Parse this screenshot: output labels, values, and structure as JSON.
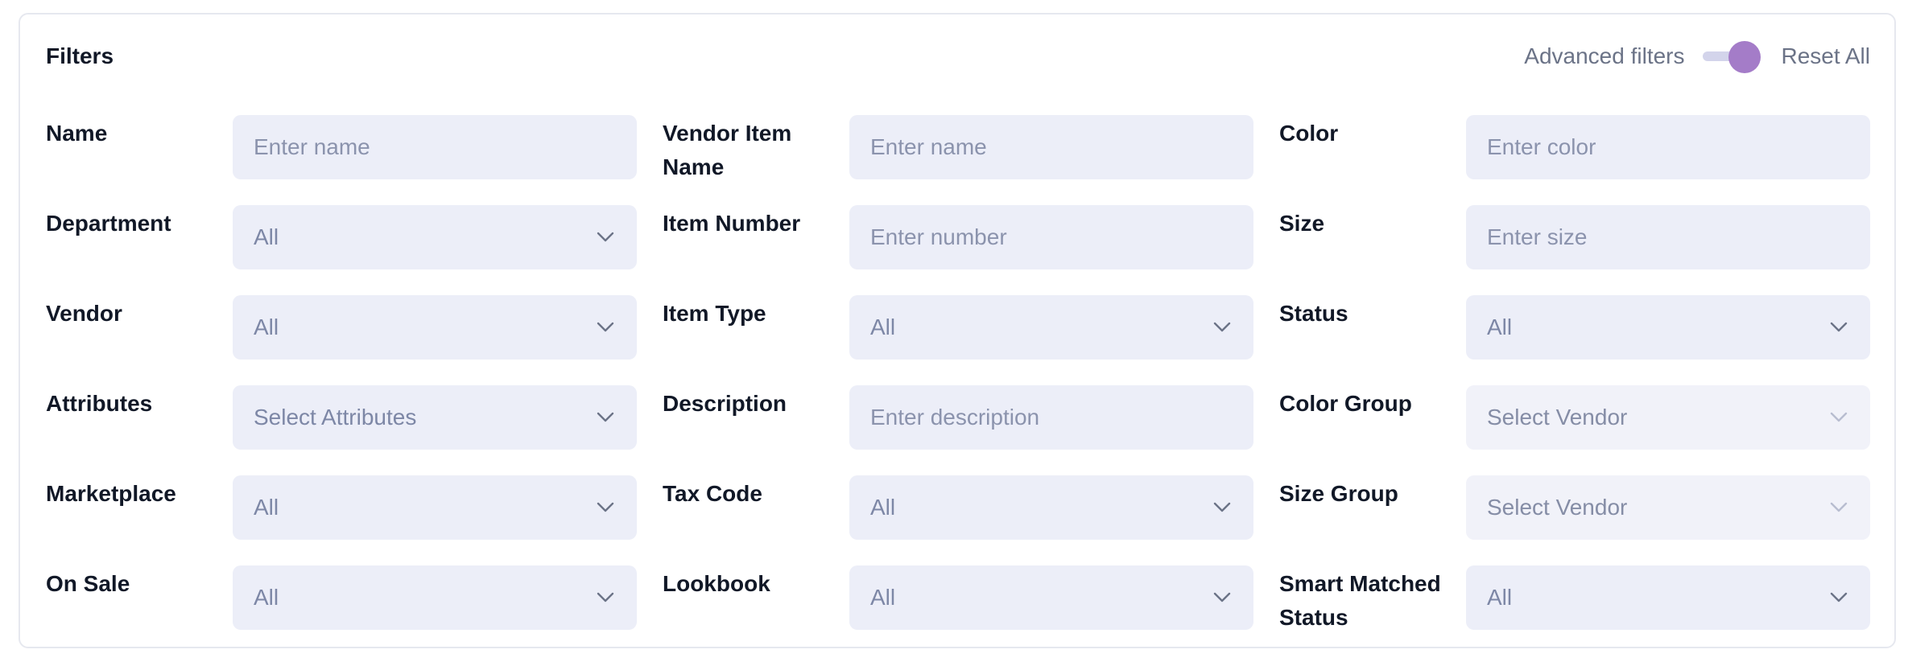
{
  "header": {
    "title": "Filters",
    "advanced_label": "Advanced filters",
    "advanced_enabled": true,
    "reset_label": "Reset All"
  },
  "colors": {
    "accent": "#a47cc8",
    "field_bg": "#eceef8",
    "label": "#111827",
    "muted": "#6b7387"
  },
  "rows": [
    [
      {
        "label": "Name",
        "type": "input",
        "placeholder": "Enter name"
      },
      {
        "label": "Vendor Item Name",
        "type": "input",
        "placeholder": "Enter name"
      },
      {
        "label": "Color",
        "type": "input",
        "placeholder": "Enter color"
      }
    ],
    [
      {
        "label": "Department",
        "type": "select",
        "value": "All"
      },
      {
        "label": "Item Number",
        "type": "input",
        "placeholder": "Enter number"
      },
      {
        "label": "Size",
        "type": "input",
        "placeholder": "Enter size"
      }
    ],
    [
      {
        "label": "Vendor",
        "type": "select",
        "value": "All"
      },
      {
        "label": "Item Type",
        "type": "select",
        "value": "All"
      },
      {
        "label": "Status",
        "type": "select",
        "value": "All"
      }
    ],
    [
      {
        "label": "Attributes",
        "type": "select",
        "value": "Select Attributes"
      },
      {
        "label": "Description",
        "type": "input",
        "placeholder": "Enter description"
      },
      {
        "label": "Color Group",
        "type": "select",
        "value": "Select Vendor",
        "disabled": true
      }
    ],
    [
      {
        "label": "Marketplace",
        "type": "select",
        "value": "All"
      },
      {
        "label": "Tax Code",
        "type": "select",
        "value": "All"
      },
      {
        "label": "Size Group",
        "type": "select",
        "value": "Select Vendor",
        "disabled": true
      }
    ],
    [
      {
        "label": "On Sale",
        "type": "select",
        "value": "All"
      },
      {
        "label": "Lookbook",
        "type": "select",
        "value": "All"
      },
      {
        "label": "Smart Matched Status",
        "type": "select",
        "value": "All"
      }
    ]
  ]
}
